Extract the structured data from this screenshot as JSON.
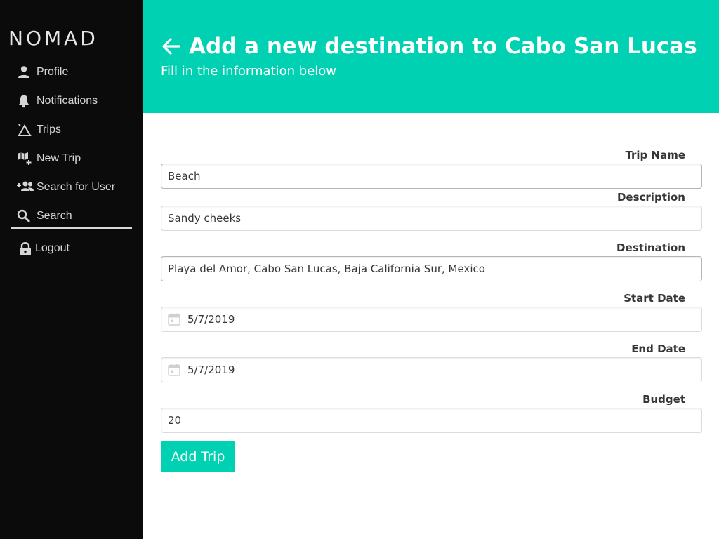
{
  "app": {
    "brand": "NOMAD"
  },
  "sidebar": {
    "items": [
      {
        "label": "Profile",
        "icon": "person-icon"
      },
      {
        "label": "Notifications",
        "icon": "bell-icon"
      },
      {
        "label": "Trips",
        "icon": "trips-icon"
      },
      {
        "label": "New Trip",
        "icon": "map-plus-icon"
      },
      {
        "label": "Search for User",
        "icon": "user-plus-icon"
      },
      {
        "label": "Search",
        "icon": "search-icon"
      }
    ],
    "logout": {
      "label": "Logout",
      "icon": "lock-icon"
    }
  },
  "header": {
    "title": "Add a new destination to Cabo San Lucas",
    "subtitle": "Fill in the information below"
  },
  "form": {
    "trip_name": {
      "label": "Trip Name",
      "value": "Beach"
    },
    "description": {
      "label": "Description",
      "value": "Sandy cheeks"
    },
    "destination": {
      "label": "Destination",
      "value": "Playa del Amor, Cabo San Lucas, Baja California Sur, Mexico"
    },
    "start_date": {
      "label": "Start Date",
      "value": "5/7/2019"
    },
    "end_date": {
      "label": "End Date",
      "value": "5/7/2019"
    },
    "budget": {
      "label": "Budget",
      "value": "20"
    },
    "submit_label": "Add Trip"
  },
  "colors": {
    "accent": "#00d1b2",
    "sidebar_bg": "#0b0b0b"
  }
}
